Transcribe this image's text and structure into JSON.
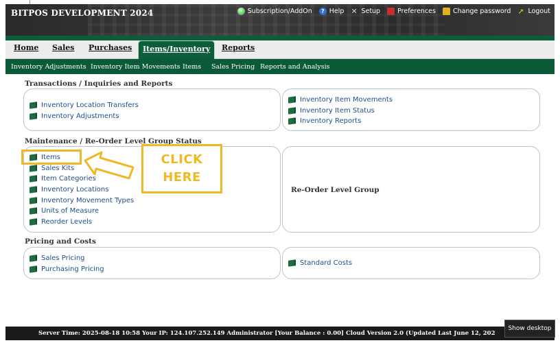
{
  "app": {
    "title": "BITPOS DEVELOPMENT 2024"
  },
  "toplinks": [
    {
      "label": "Subscription/AddOn",
      "icon": "subscription-icon"
    },
    {
      "label": "Help",
      "icon": "help-icon"
    },
    {
      "label": "Setup",
      "icon": "setup-icon"
    },
    {
      "label": "Preferences",
      "icon": "preferences-icon"
    },
    {
      "label": "Change password",
      "icon": "lock-icon"
    },
    {
      "label": "Logout",
      "icon": "logout-icon"
    }
  ],
  "tabs": [
    {
      "label": "Home"
    },
    {
      "label": "Sales"
    },
    {
      "label": "Purchases"
    },
    {
      "label": "Items/Inventory",
      "active": true
    },
    {
      "label": "Reports"
    }
  ],
  "submenu": [
    {
      "label": "Inventory Adjustments"
    },
    {
      "label": "Inventory Item Movements"
    },
    {
      "label": "Items"
    },
    {
      "label": "Sales Pricing"
    },
    {
      "label": "Reports and Analysis"
    }
  ],
  "sections": {
    "transactions": {
      "title": "Transactions / Inquiries and Reports",
      "left": [
        "Inventory Location Transfers",
        "Inventory Adjustments"
      ],
      "right": [
        "Inventory Item Movements",
        "Inventory Item Status",
        "Inventory Reports"
      ]
    },
    "maintenance": {
      "title": "Maintenance / Re-Order Level Group Status",
      "left": [
        "Items",
        "Sales Kits",
        "Item Categories",
        "Inventory Locations",
        "Inventory Movement Types",
        "Units of Measure",
        "Reorder Levels"
      ],
      "right_label": "Re-Order Level Group"
    },
    "pricing": {
      "title": "Pricing and Costs",
      "left": [
        "Sales Pricing",
        "Purchasing Pricing"
      ],
      "right": [
        "Standard Costs"
      ]
    }
  },
  "annotation": {
    "line1": "CLICK",
    "line2": "HERE",
    "color": "#f0b822"
  },
  "footer": {
    "text": "Server Time: 2025-08-18 10:58     Your IP: 124.107.252.149     Administrator     [Your Balance : 0.00] Cloud Version 2.0 (Updated Last June 12, 202",
    "show_desktop": "Show desktop"
  },
  "colors": {
    "brand_green": "#0d5d3a",
    "link_blue": "#1d4e8a",
    "header_dark": "#2c2c2c"
  }
}
